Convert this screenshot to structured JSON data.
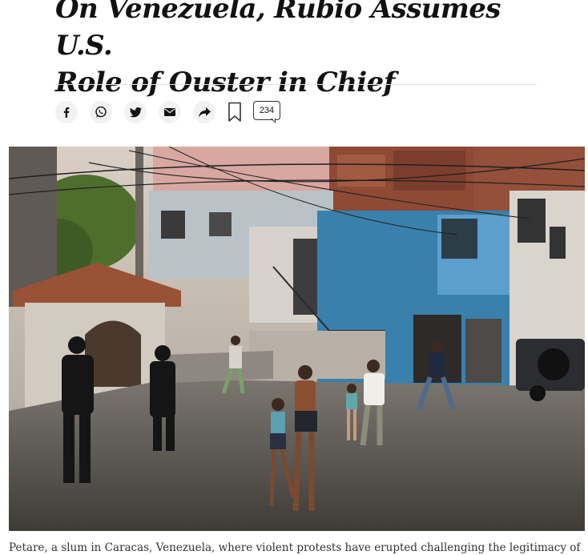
{
  "article": {
    "headline_line1": "On Venezuela, Rubio Assumes U.S.",
    "headline_line2": "Role of Ouster in Chief",
    "caption": "Petare, a slum in Caracas, Venezuela, where violent protests have erupted challenging the legitimacy of"
  },
  "share_tools": {
    "items": [
      {
        "name": "facebook",
        "icon": "facebook-icon"
      },
      {
        "name": "whatsapp",
        "icon": "whatsapp-icon"
      },
      {
        "name": "twitter",
        "icon": "twitter-icon"
      },
      {
        "name": "email",
        "icon": "email-icon"
      },
      {
        "name": "share",
        "icon": "share-arrow-icon"
      }
    ],
    "bookmark_icon": "bookmark-icon",
    "comment_count": "234"
  },
  "colors": {
    "text": "#121212",
    "button_bg": "#f2f2f2",
    "divider": "#e2e2e2",
    "caption_text": "#333333"
  }
}
